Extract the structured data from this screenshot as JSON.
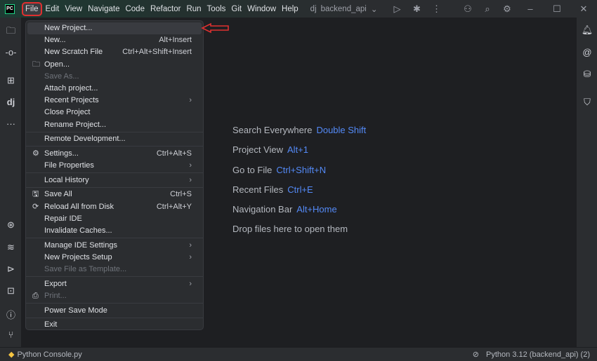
{
  "titlebar": {
    "menus": [
      "File",
      "Edit",
      "View",
      "Navigate",
      "Code",
      "Refactor",
      "Run",
      "Tools",
      "Git",
      "Window",
      "Help"
    ],
    "active_menu": "File",
    "project_icon": "dj",
    "project": "backend_api"
  },
  "file_menu": [
    {
      "label": "New Project...",
      "highlight": true
    },
    {
      "label": "New...",
      "shortcut": "Alt+Insert"
    },
    {
      "label": "New Scratch File",
      "shortcut": "Ctrl+Alt+Shift+Insert"
    },
    {
      "label": "Open...",
      "icon": "folder-icon"
    },
    {
      "label": "Save As...",
      "disabled": true
    },
    {
      "label": "Attach project..."
    },
    {
      "label": "Recent Projects",
      "submenu": true
    },
    {
      "label": "Close Project"
    },
    {
      "label": "Rename Project...",
      "sep_after": true
    },
    {
      "label": "Remote Development...",
      "sep_after": true
    },
    {
      "label": "Settings...",
      "shortcut": "Ctrl+Alt+S",
      "icon": "gear-icon"
    },
    {
      "label": "File Properties",
      "submenu": true,
      "sep_after": true
    },
    {
      "label": "Local History",
      "submenu": true,
      "sep_after": true
    },
    {
      "label": "Save All",
      "shortcut": "Ctrl+S",
      "icon": "save-icon"
    },
    {
      "label": "Reload All from Disk",
      "shortcut": "Ctrl+Alt+Y",
      "icon": "reload-icon"
    },
    {
      "label": "Repair IDE"
    },
    {
      "label": "Invalidate Caches...",
      "sep_after": true
    },
    {
      "label": "Manage IDE Settings",
      "submenu": true
    },
    {
      "label": "New Projects Setup",
      "submenu": true
    },
    {
      "label": "Save File as Template...",
      "disabled": true,
      "sep_after": true
    },
    {
      "label": "Export",
      "submenu": true
    },
    {
      "label": "Print...",
      "disabled": true,
      "icon": "print-icon",
      "sep_after": true
    },
    {
      "label": "Power Save Mode",
      "sep_after": true
    },
    {
      "label": "Exit"
    }
  ],
  "welcome": [
    {
      "text": "Search Everywhere",
      "key": "Double Shift"
    },
    {
      "text": "Project View",
      "key": "Alt+1"
    },
    {
      "text": "Go to File",
      "key": "Ctrl+Shift+N"
    },
    {
      "text": "Recent Files",
      "key": "Ctrl+E"
    },
    {
      "text": "Navigation Bar",
      "key": "Alt+Home"
    },
    {
      "text": "Drop files here to open them",
      "key": ""
    }
  ],
  "statusbar": {
    "file": "Python Console.py",
    "interpreter": "Python 3.12 (backend_api) (2)"
  },
  "colors": {
    "accent": "#548af7",
    "annotation": "#e03030"
  }
}
